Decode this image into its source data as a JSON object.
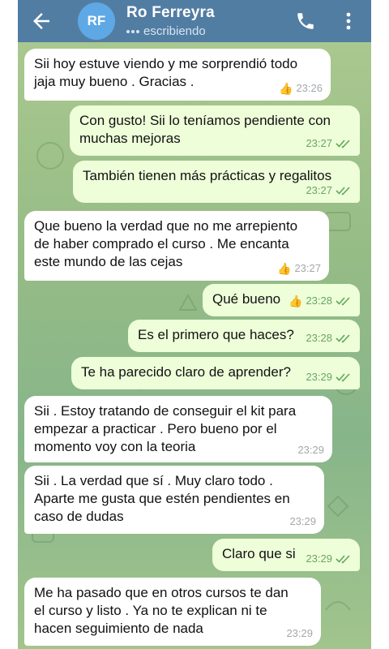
{
  "header": {
    "avatar_initials": "RF",
    "contact_name": "Ro Ferreyra",
    "status": "escribiendo",
    "colors": {
      "bar": "#527da3",
      "avatar": "#5fa8e6"
    }
  },
  "messages": [
    {
      "dir": "in",
      "text": "Sii hoy estuve viendo y me sorprendió todo\njaja muy bueno . Gracias .",
      "time": "23:26",
      "reaction": "👍"
    },
    {
      "dir": "out",
      "text": "Con gusto! Sii lo teníamos pendiente con\nmuchas mejoras",
      "time": "23:27",
      "read": true
    },
    {
      "dir": "out",
      "text": "También tienen más prácticas y regalitos",
      "time": "23:27",
      "read": true
    },
    {
      "dir": "in",
      "text": "Que bueno la verdad que no me arrepiento\nde haber comprado el curso . Me encanta\neste mundo de las cejas",
      "time": "23:27",
      "reaction": "👍"
    },
    {
      "dir": "out",
      "text": "Qué bueno",
      "time": "23:28",
      "read": true,
      "reaction": "👍"
    },
    {
      "dir": "out",
      "text": "Es el primero que haces?",
      "time": "23:28",
      "read": true
    },
    {
      "dir": "out",
      "text": "Te ha parecido claro de aprender?",
      "time": "23:29",
      "read": true
    },
    {
      "dir": "in",
      "text": "Sii . Estoy tratando de conseguir el kit para\nempezar a practicar . Pero bueno por el\nmomento voy con la teoria",
      "time": "23:29"
    },
    {
      "dir": "in",
      "text": "Sii . La verdad que sí . Muy claro todo .\nAparte me gusta que estén pendientes en\ncaso de dudas",
      "time": "23:29"
    },
    {
      "dir": "out",
      "text": "Claro que si",
      "time": "23:29",
      "read": true
    },
    {
      "dir": "in",
      "text": "Me ha pasado que en otros cursos te dan\nel curso y listo . Ya no te explican ni te\nhacen seguimiento de nada",
      "time": "23:29"
    }
  ]
}
